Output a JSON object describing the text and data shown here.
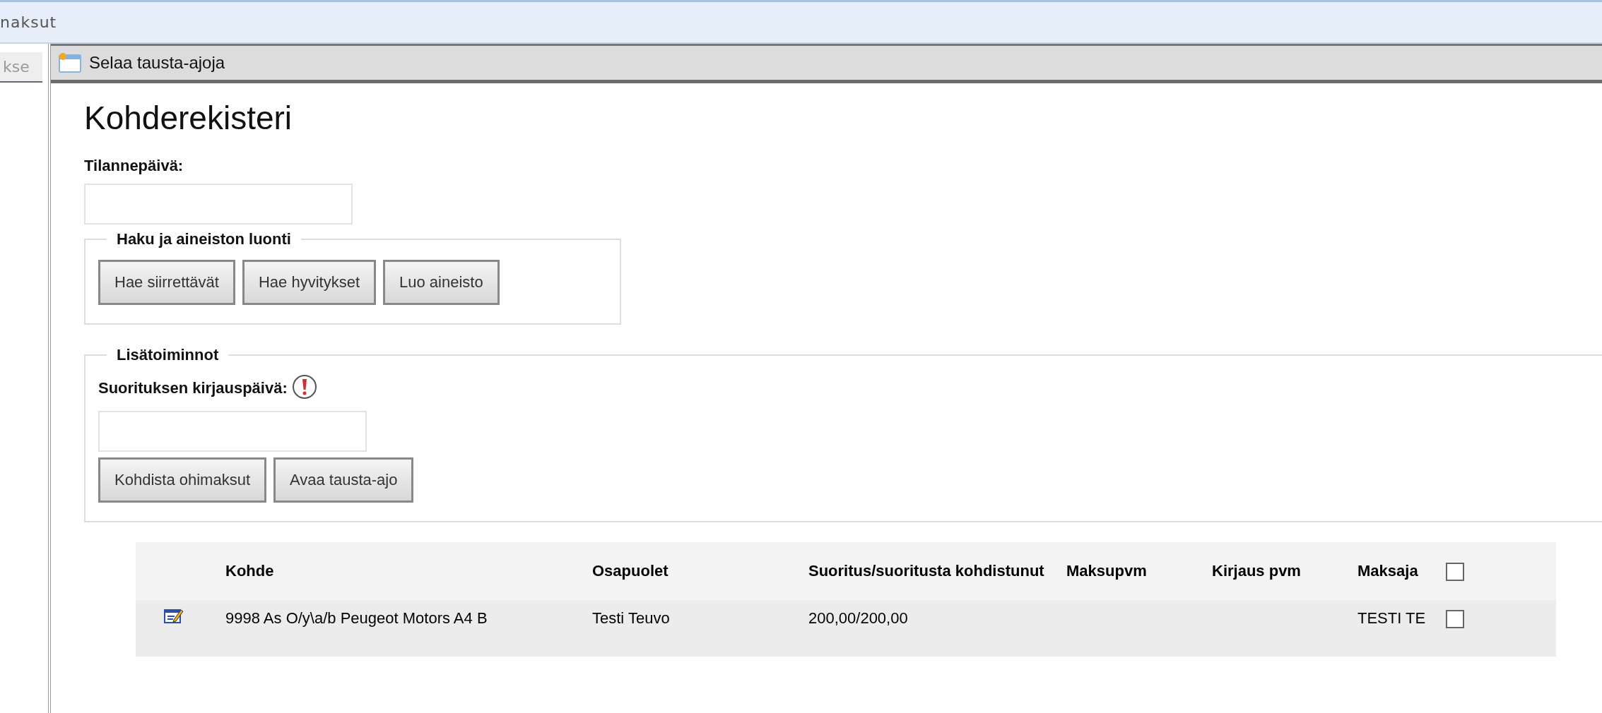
{
  "app_bar": {
    "title": "naksut"
  },
  "side_tab": {
    "label": "kse"
  },
  "window": {
    "title": "Selaa tausta-ajoja"
  },
  "heading": "Kohderekisteri",
  "status_date": {
    "label": "Tilannepäivä:"
  },
  "search_group": {
    "legend": "Haku ja aineiston luonti",
    "buttons": [
      "Hae siirrettävät",
      "Hae hyvitykset",
      "Luo aineisto"
    ]
  },
  "extra_group": {
    "legend": "Lisätoiminnot",
    "date_label": "Suorituksen kirjauspäivä:",
    "required": true,
    "buttons": [
      "Kohdista ohimaksut",
      "Avaa tausta-ajo"
    ]
  },
  "table": {
    "columns": [
      "Kohde",
      "Osapuolet",
      "Suoritus/suoritusta kohdistunut",
      "Maksupvm",
      "Kirjaus pvm",
      "Maksaja"
    ],
    "select_all": {
      "checked": false
    },
    "rows": [
      {
        "cells": [
          "9998 As O/y\\a/b Peugeot Motors A4 B",
          "Testi Teuvo",
          "200,00/200,00",
          "",
          "",
          "TESTI TE"
        ],
        "checked": false
      }
    ]
  }
}
